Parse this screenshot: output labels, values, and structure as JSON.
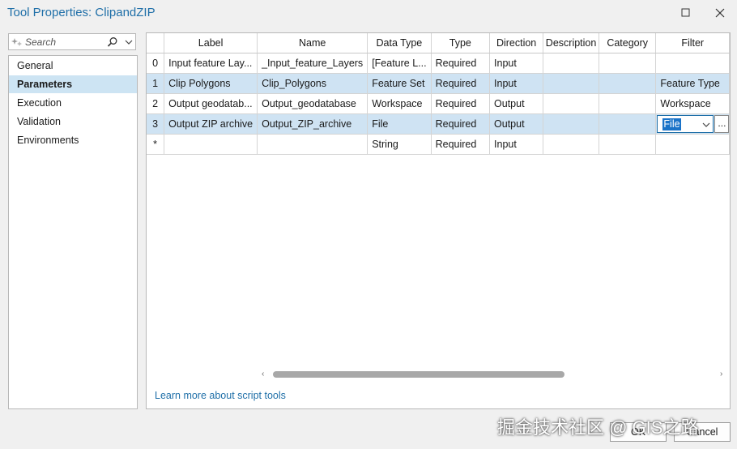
{
  "window": {
    "title": "Tool Properties: ClipandZIP"
  },
  "search": {
    "placeholder": "Search"
  },
  "sidebar": {
    "items": [
      {
        "label": "General"
      },
      {
        "label": "Parameters"
      },
      {
        "label": "Execution"
      },
      {
        "label": "Validation"
      },
      {
        "label": "Environments"
      }
    ],
    "active": "Parameters"
  },
  "grid": {
    "columns": [
      "Label",
      "Name",
      "Data Type",
      "Type",
      "Direction",
      "Description",
      "Category",
      "Filter"
    ],
    "rows": [
      {
        "num": "0",
        "label": "Input feature Lay...",
        "name": "_Input_feature_Layers",
        "data_type": "[Feature L...",
        "type": "Required",
        "direction": "Input",
        "description": "",
        "category": "",
        "filter": ""
      },
      {
        "num": "1",
        "label": "Clip Polygons",
        "name": "Clip_Polygons",
        "data_type": "Feature Set",
        "type": "Required",
        "direction": "Input",
        "description": "",
        "category": "",
        "filter": "Feature Type"
      },
      {
        "num": "2",
        "label": "Output geodatab...",
        "name": "Output_geodatabase",
        "data_type": "Workspace",
        "type": "Required",
        "direction": "Output",
        "description": "",
        "category": "",
        "filter": "Workspace"
      },
      {
        "num": "3",
        "label": "Output ZIP archive",
        "name": "Output_ZIP_archive",
        "data_type": "File",
        "type": "Required",
        "direction": "Output",
        "description": "",
        "category": "",
        "filter": "File"
      },
      {
        "num": "*",
        "label": "",
        "name": "",
        "data_type": "String",
        "type": "Required",
        "direction": "Input",
        "description": "",
        "category": "",
        "filter": ""
      }
    ],
    "filter_button": "..."
  },
  "footer": {
    "learn_link": "Learn more about script tools",
    "ok": "OK",
    "cancel": "Cancel"
  },
  "watermark": "掘金技术社区 @ GIS之路"
}
